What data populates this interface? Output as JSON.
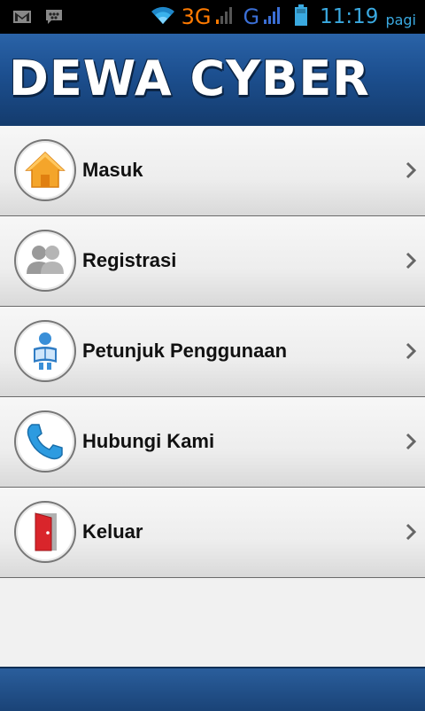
{
  "status_bar": {
    "network_3g": "3G",
    "network_g": "G",
    "time": "11:19",
    "time_suffix": "pagi",
    "icons": [
      "gmail-icon",
      "bbm-icon",
      "wifi-icon",
      "signal-icon",
      "signal-icon",
      "battery-icon"
    ]
  },
  "header": {
    "title": "DEWA CYBER"
  },
  "menu": {
    "items": [
      {
        "label": "Masuk",
        "icon": "home-icon"
      },
      {
        "label": "Registrasi",
        "icon": "users-icon"
      },
      {
        "label": "Petunjuk Penggunaan",
        "icon": "reading-person-icon"
      },
      {
        "label": "Hubungi Kami",
        "icon": "phone-icon"
      },
      {
        "label": "Keluar",
        "icon": "exit-door-icon"
      }
    ]
  },
  "colors": {
    "header_blue": "#1c4f8f",
    "accent_orange": "#ff7a00",
    "clock_blue": "#3aa9e0"
  }
}
